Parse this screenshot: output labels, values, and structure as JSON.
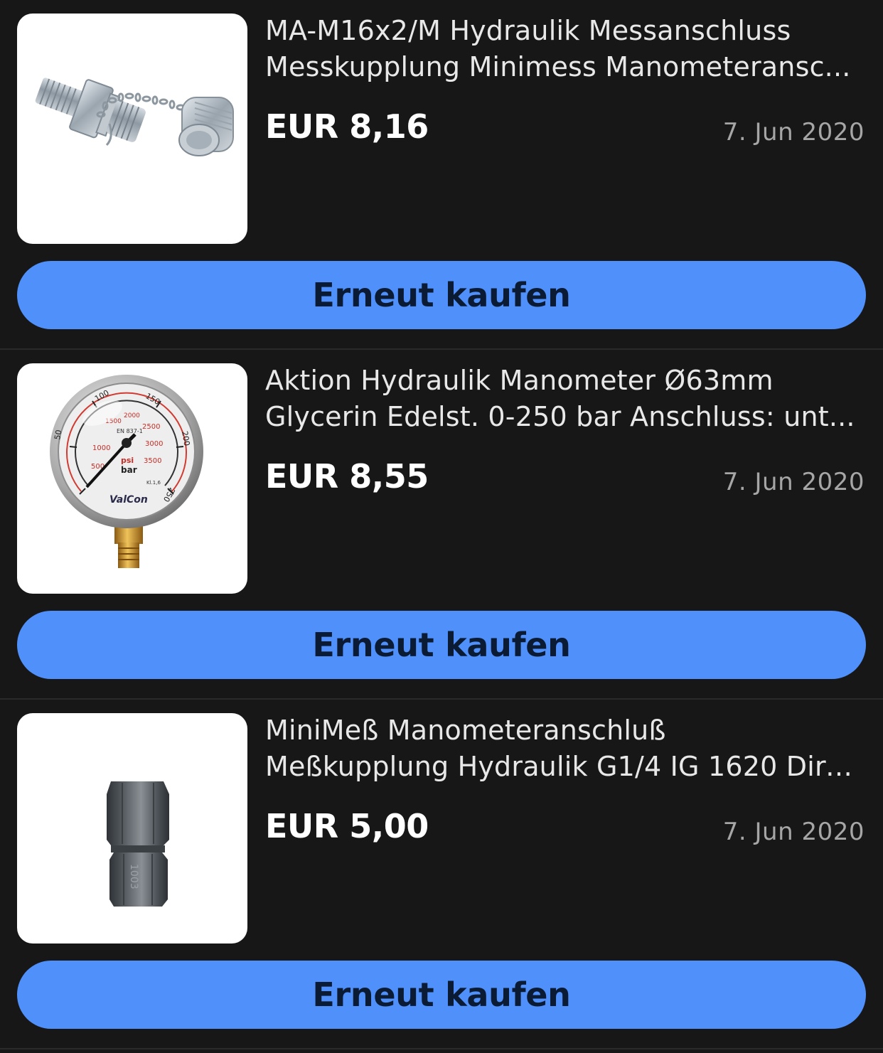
{
  "orders": [
    {
      "title_line1": "MA-M16x2/M Hydraulik Messanschluss",
      "title_line2": "Messkupplung Minimess Manometeransc...",
      "price": "EUR 8,16",
      "date": "7. Jun 2020",
      "button_label": "Erneut kaufen",
      "image_icon": "hydraulic-test-coupling-image"
    },
    {
      "title_line1": "Aktion Hydraulik Manometer Ø63mm",
      "title_line2": "Glycerin Edelst. 0-250 bar Anschluss: unt...",
      "price": "EUR 8,55",
      "date": "7. Jun 2020",
      "button_label": "Erneut kaufen",
      "image_icon": "pressure-gauge-image",
      "gauge_text": {
        "bar_ticks": [
          "50",
          "100",
          "150",
          "200",
          "250"
        ],
        "psi_ticks": [
          "500",
          "1000",
          "1500",
          "2000",
          "2500",
          "3000",
          "3500"
        ],
        "units": [
          "psi",
          "bar"
        ],
        "brand": "ValCon",
        "standard": "EN 837-1",
        "class": "Kl.1,6"
      }
    },
    {
      "title_line1": "MiniMeß Manometeranschluß",
      "title_line2": "Meßkupplung Hydraulik G1/4 IG 1620 Dire...",
      "price": "EUR 5,00",
      "date": "7. Jun 2020",
      "button_label": "Erneut kaufen",
      "image_icon": "adapter-fitting-image",
      "fitting_text": "1003"
    }
  ],
  "colors": {
    "background": "#171717",
    "button": "#4f90fb",
    "button_text": "#0b1b33",
    "date_text": "#a6a6a6"
  }
}
